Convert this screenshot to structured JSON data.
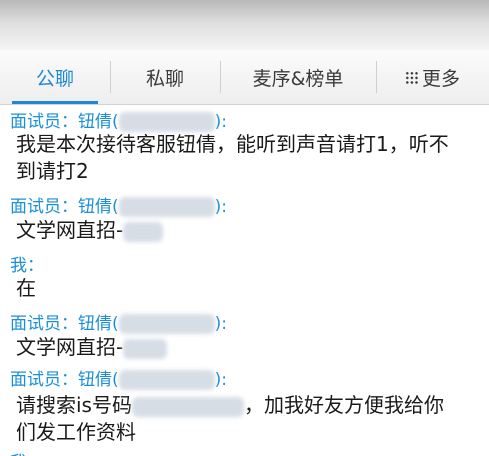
{
  "tabs": [
    {
      "label": "公聊",
      "active": true
    },
    {
      "label": "私聊",
      "active": false
    },
    {
      "label": "麦序&榜单",
      "active": false
    },
    {
      "label": "更多",
      "active": false,
      "icon": "grid-dots-icon"
    }
  ],
  "colors": {
    "accent": "#1e88d6",
    "sender": "#1b8fd8",
    "text": "#1a1a1a"
  },
  "messages": [
    {
      "sender_prefix": "面试员：钮倩(",
      "sender_suffix": "):",
      "lines": [
        "我是本次接待客服钮倩，能听到声音请打1，听不",
        "到请打2"
      ]
    },
    {
      "sender_prefix": "面试员：钮倩(",
      "sender_suffix": "):",
      "lines": [
        "文学网直招-"
      ]
    },
    {
      "sender_prefix": "我：",
      "lines": [
        "在"
      ]
    },
    {
      "sender_prefix": "面试员：钮倩(",
      "sender_suffix": "):",
      "lines": [
        "文学网直招-"
      ]
    },
    {
      "sender_prefix": "面试员：钮倩(",
      "sender_suffix": "):",
      "line1_prefix": "请搜索is号码",
      "line1_suffix": "，加我好友方便我给你",
      "line2": "们发工作资料"
    }
  ]
}
